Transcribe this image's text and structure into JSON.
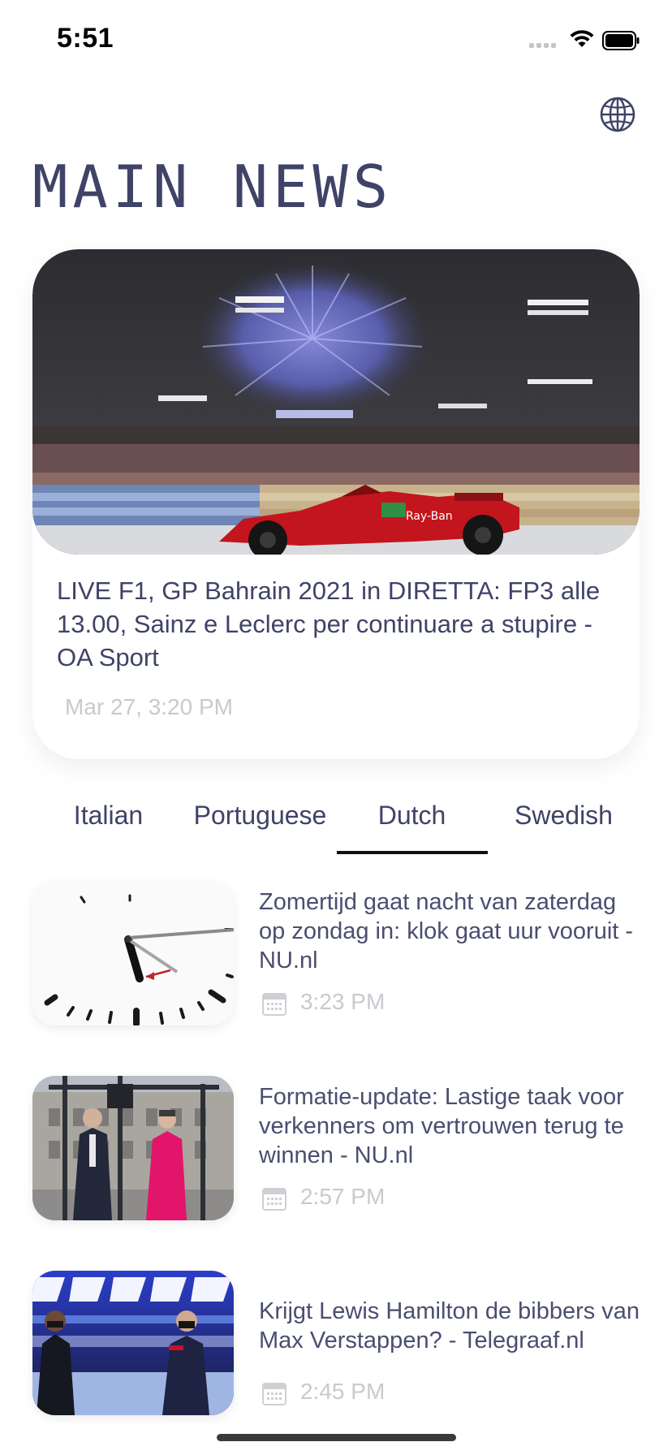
{
  "status_bar": {
    "time": "5:51"
  },
  "header": {
    "title": "MAIN NEWS",
    "language_icon": "globe-icon"
  },
  "hero": {
    "headline": "LIVE F1, GP Bahrain 2021 in DIRETTA: FP3 alle 13.00, Sainz e Leclerc per continuare a stupire - OA Sport",
    "date": "Mar 27, 3:20 PM"
  },
  "tabs": [
    {
      "label": "Italian"
    },
    {
      "label": "Portuguese"
    },
    {
      "label": "Dutch"
    },
    {
      "label": "Swedish"
    }
  ],
  "selected_tab": "Dutch",
  "news": [
    {
      "title": "Zomertijd gaat nacht van zaterdag op zondag in: klok gaat uur vooruit - NU.nl",
      "time": "3:23 PM"
    },
    {
      "title": "Formatie-update: Lastige taak voor verkenners om vertrouwen terug te winnen - NU.nl",
      "time": "2:57 PM"
    },
    {
      "title": "Krijgt Lewis Hamilton de bibbers van Max Verstappen? - Telegraaf.nl",
      "time": "2:45 PM"
    }
  ],
  "colors": {
    "text": "#3f4367",
    "muted": "#c9c9cf",
    "tab_indicator": "#101015"
  }
}
